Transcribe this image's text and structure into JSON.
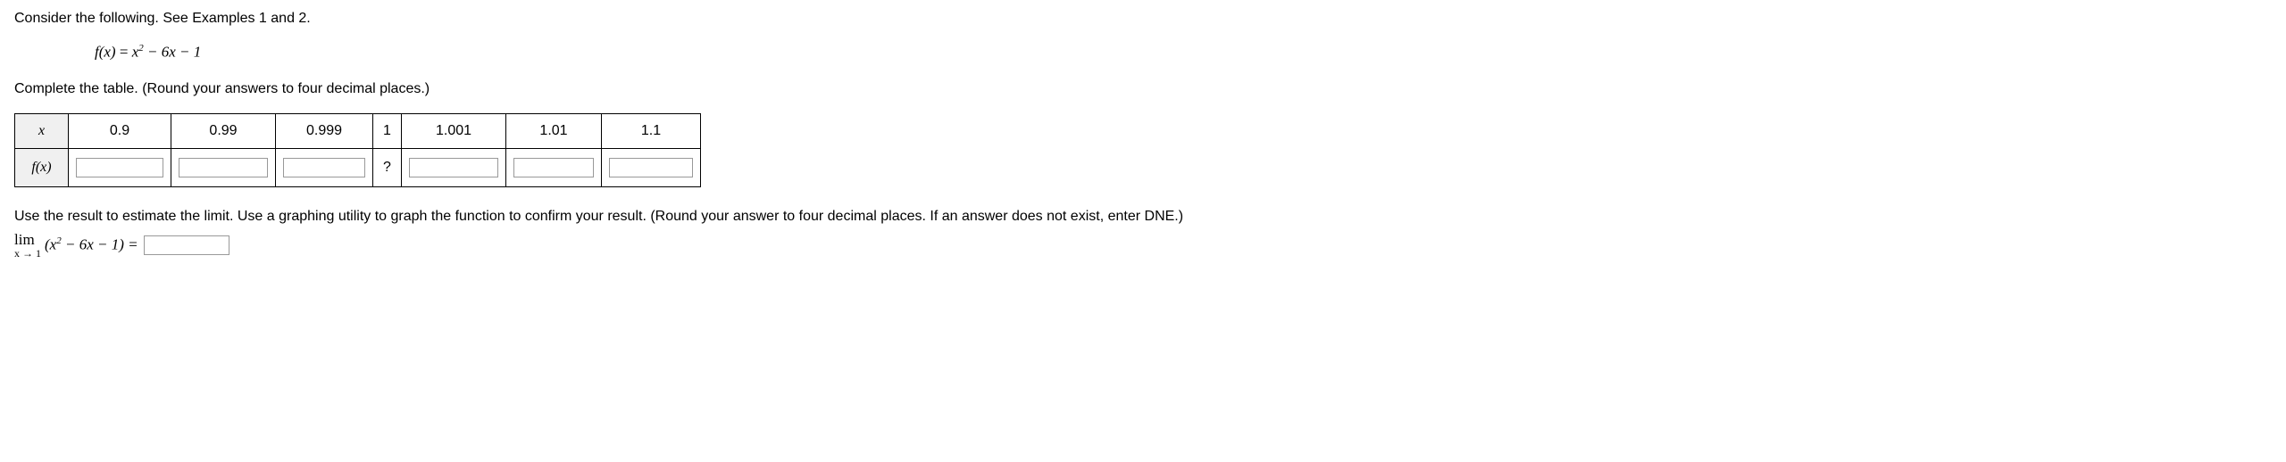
{
  "intro": "Consider the following. See Examples 1 and 2.",
  "formula": {
    "lhs": "f(x)",
    "rhs_parts": [
      "x",
      "2",
      " − 6x − 1"
    ]
  },
  "table_instruction": "Complete the table. (Round your answers to four decimal places.)",
  "table": {
    "row_header_x": "x",
    "row_header_fx": "f(x)",
    "x_values": [
      "0.9",
      "0.99",
      "0.999",
      "1",
      "1.001",
      "1.01",
      "1.1"
    ],
    "center_symbol": "?"
  },
  "estimate_instruction": "Use the result to estimate the limit. Use a graphing utility to graph the function to confirm your result. (Round your answer to four decimal places. If an answer does not exist, enter DNE.)",
  "limit": {
    "lim_text": "lim",
    "approach": "x → 1",
    "expr_open": "(x",
    "expr_sup": "2",
    "expr_tail": " − 6x − 1) = "
  },
  "chart_data": {
    "type": "table",
    "columns": [
      "x",
      "f(x)"
    ],
    "rows": [
      {
        "x": 0.9,
        "fx": null
      },
      {
        "x": 0.99,
        "fx": null
      },
      {
        "x": 0.999,
        "fx": null
      },
      {
        "x": 1,
        "fx": "?"
      },
      {
        "x": 1.001,
        "fx": null
      },
      {
        "x": 1.01,
        "fx": null
      },
      {
        "x": 1.1,
        "fx": null
      }
    ],
    "function": "f(x) = x^2 - 6x - 1",
    "limit_point": 1,
    "limit_value": null
  }
}
